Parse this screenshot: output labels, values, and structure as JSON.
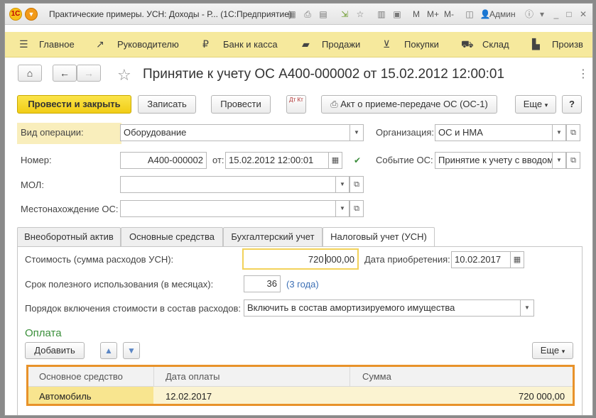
{
  "window": {
    "title": "Практические примеры. УСН: Доходы - Р...  (1С:Предприятие)",
    "toolbar_icons": [
      "grid-icon",
      "print-icon",
      "doc-icon",
      "link-icon",
      "favorite-icon",
      "calendar-icon",
      "calendar31-icon"
    ],
    "memory_labels": [
      "M",
      "M+",
      "M-"
    ],
    "user": "Админ",
    "info_icon": "info-icon"
  },
  "sections": [
    {
      "label": "Главное",
      "icon": "menu-icon"
    },
    {
      "label": "Руководителю",
      "icon": "chart-icon"
    },
    {
      "label": "Банк и касса",
      "icon": "ruble-icon"
    },
    {
      "label": "Продажи",
      "icon": "bag-icon"
    },
    {
      "label": "Покупки",
      "icon": "cart-icon"
    },
    {
      "label": "Склад",
      "icon": "truck-icon"
    },
    {
      "label": "Произв",
      "icon": "factory-icon"
    }
  ],
  "document": {
    "title": "Принятие к учету ОС А400-000002 от 15.02.2012 12:00:01"
  },
  "actions": {
    "post_and_close": "Провести и закрыть",
    "save": "Записать",
    "post": "Провести",
    "dt_kt": "Дт Кт",
    "act_print": "Акт о приеме-передаче ОС (ОС-1)",
    "more": "Еще",
    "help": "?"
  },
  "form": {
    "operation_label": "Вид операции:",
    "operation_value": "Оборудование",
    "organization_label": "Организация:",
    "organization_value": "ОС и НМА",
    "number_label": "Номер:",
    "number_value": "А400-000002",
    "from_label": "от:",
    "date_value": "15.02.2012 12:00:01",
    "event_label": "Событие ОС:",
    "event_value": "Принятие к учету с вводом",
    "mol_label": "МОЛ:",
    "mol_value": "",
    "location_label": "Местонахождение ОС:",
    "location_value": ""
  },
  "tabs": [
    {
      "label": "Внеоборотный актив"
    },
    {
      "label": "Основные средства"
    },
    {
      "label": "Бухгалтерский учет"
    },
    {
      "label": "Налоговый учет (УСН)",
      "active": true
    }
  ],
  "tax": {
    "cost_label": "Стоимость (сумма расходов УСН):",
    "cost_value": "720 000,00",
    "acq_date_label": "Дата приобретения:",
    "acq_date_value": "10.02.2017",
    "life_label": "Срок полезного использования (в месяцах):",
    "life_value": "36",
    "life_hint": "(3 года)",
    "order_label": "Порядок включения стоимости в состав расходов:",
    "order_value": "Включить в состав амортизируемого имущества"
  },
  "payment": {
    "title": "Оплата",
    "add_label": "Добавить",
    "more_label": "Еще",
    "columns": [
      "Основное средство",
      "Дата оплаты",
      "Сумма"
    ],
    "rows": [
      {
        "asset": "Автомобиль",
        "date": "12.02.2017",
        "sum": "720 000,00"
      }
    ]
  }
}
